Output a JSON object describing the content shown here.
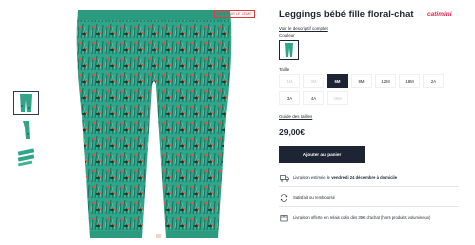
{
  "product": {
    "title": "Leggings bébé fille floral-chat",
    "brand": "catimini",
    "promo_badge": "-30% SUR LE 2EME",
    "description_link": "Voir le descriptif complet",
    "color_label": "Couleur",
    "size_label": "Taille",
    "size_guide_link": "Guide des tailles",
    "price": "29,00€",
    "add_to_cart_label": "Ajouter au panier",
    "sizes": [
      {
        "label": "1M",
        "state": "disabled"
      },
      {
        "label": "3M",
        "state": "disabled"
      },
      {
        "label": "6M",
        "state": "selected"
      },
      {
        "label": "9M",
        "state": "available"
      },
      {
        "label": "12M",
        "state": "available"
      },
      {
        "label": "18M",
        "state": "available"
      },
      {
        "label": "2A",
        "state": "available"
      },
      {
        "label": "3A",
        "state": "available"
      },
      {
        "label": "4A",
        "state": "available"
      },
      {
        "label": "36M",
        "state": "disabled"
      }
    ]
  },
  "features": {
    "delivery_prefix": "Livraison estimée le",
    "delivery_date": "vendredi 24 décembre à domicile",
    "returns": "Satisfait ou remboursé",
    "free_shipping": "Livraison offerte en relais colis dès 39€ d'achat (hors produits volumineux)"
  },
  "colors": {
    "navy": "#1d2433",
    "accent_red": "#e4224b",
    "legging_green": "#2fa58a",
    "legging_dark": "#1f6b5a",
    "flower_red": "#e0553e"
  },
  "icons": [
    "truck-icon",
    "return-arrows-icon",
    "package-icon"
  ]
}
